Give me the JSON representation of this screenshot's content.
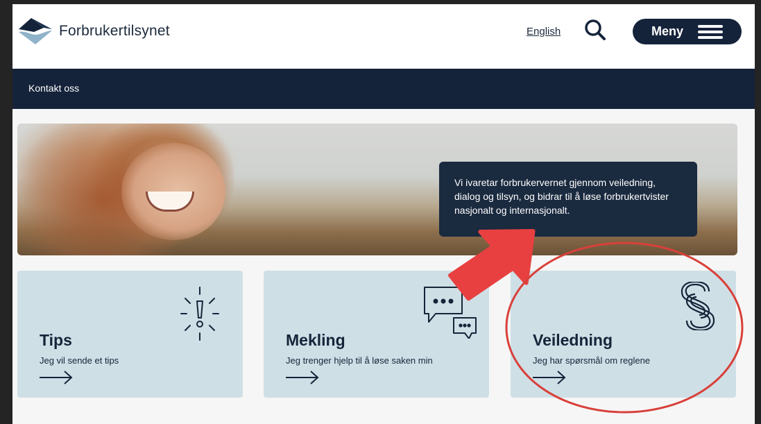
{
  "header": {
    "logo_text": "Forbrukertilsynet",
    "language_link": "English",
    "menu_label": "Meny"
  },
  "subnav": {
    "contact_link": "Kontakt oss"
  },
  "hero": {
    "caption": "Vi ivaretar forbrukervernet gjennom veiledning, dialog og tilsyn, og bidrar til å løse forbrukertvister nasjonalt og internasjonalt."
  },
  "cards": [
    {
      "title": "Tips",
      "description": "Jeg vil sende et tips",
      "icon": "exclamation-burst-icon"
    },
    {
      "title": "Mekling",
      "description": "Jeg trenger hjelp til å løse saken min",
      "icon": "chat-bubbles-icon"
    },
    {
      "title": "Veiledning",
      "description": "Jeg har spørsmål om reglene",
      "icon": "paragraph-icon"
    }
  ],
  "colors": {
    "brand_navy": "#14233a",
    "card_background": "#cfdfe6",
    "annotation_red": "#e84040"
  }
}
